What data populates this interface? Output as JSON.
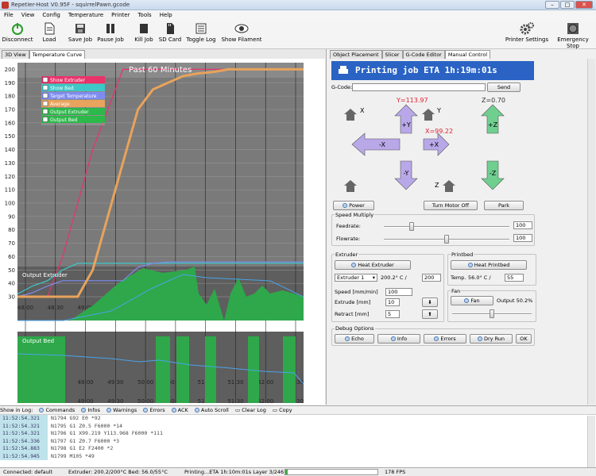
{
  "window": {
    "title": "Repetier-Host V0.95F - squirrelPawn.gcode"
  },
  "menu": [
    "File",
    "View",
    "Config",
    "Temperature",
    "Printer",
    "Tools",
    "Help"
  ],
  "toolbar": {
    "left": [
      {
        "name": "disconnect",
        "label": "Disconnect",
        "icon": "power-icon"
      },
      {
        "name": "load",
        "label": "Load",
        "icon": "document-icon"
      },
      {
        "name": "save-job",
        "label": "Save Job",
        "icon": "save-icon"
      },
      {
        "name": "pause-job",
        "label": "Pause Job",
        "icon": "pause-icon"
      },
      {
        "name": "kill-job",
        "label": "Kill Job",
        "icon": "stop-icon"
      },
      {
        "name": "sd-card",
        "label": "SD Card",
        "icon": "sd-card-icon"
      },
      {
        "name": "toggle-log",
        "label": "Toggle Log",
        "icon": "log-icon"
      },
      {
        "name": "show-filament",
        "label": "Show Filament",
        "icon": "eye-icon"
      }
    ],
    "right": [
      {
        "name": "printer-settings",
        "label": "Printer Settings",
        "icon": "gear-icon"
      },
      {
        "name": "emergency-stop",
        "label": "Emergency Stop",
        "icon": "emergency-icon"
      }
    ]
  },
  "left_tabs": [
    "3D View",
    "Temperature Curve"
  ],
  "right_tabs": [
    "Object Placement",
    "Slicer",
    "G-Code Editor",
    "Manual Control"
  ],
  "chart_data": {
    "type": "line",
    "title": "Past 60 Minutes",
    "x": [
      "48:00",
      "48:30",
      "49:00",
      "49:30",
      "50:00",
      "50:30",
      "51:00",
      "51:30",
      "52:00",
      "52:30"
    ],
    "ylim": [
      0,
      200
    ],
    "yticks": [
      200,
      190,
      180,
      170,
      160,
      150,
      140,
      130,
      120,
      110,
      100,
      90,
      80,
      70,
      60,
      50,
      40,
      30
    ],
    "legend": [
      {
        "label": "Show Extruder",
        "color": "#e8336b"
      },
      {
        "label": "Show Bed",
        "color": "#3ec7c7"
      },
      {
        "label": "Target Temperature",
        "color": "#7e8cf0"
      },
      {
        "label": "Average",
        "color": "#e8a35c"
      },
      {
        "label": "Output Extruder",
        "color": "#2db84a"
      },
      {
        "label": "Output Bed",
        "color": "#2db84a"
      }
    ],
    "series": [
      {
        "name": "Show Extruder",
        "color": "#e8336b",
        "values": [
          30,
          30,
          30,
          60,
          100,
          140,
          170,
          200,
          200,
          200,
          200,
          200,
          200,
          200,
          200,
          200,
          200,
          200,
          200,
          200
        ]
      },
      {
        "name": "Show Bed",
        "color": "#3ec7c7",
        "values": [
          32,
          38,
          42,
          50,
          55,
          55,
          55,
          55,
          55,
          55,
          55,
          55,
          55,
          55,
          55,
          55,
          55,
          55,
          55,
          55
        ]
      },
      {
        "name": "Target Temperature",
        "color": "#7e8cf0",
        "values": [
          30,
          33,
          38,
          42,
          42,
          42,
          42,
          42,
          52,
          55,
          56,
          56,
          56,
          56,
          56,
          56,
          56,
          56,
          56,
          56
        ]
      },
      {
        "name": "Average",
        "color": "#e8a35c",
        "values": [
          30,
          30,
          30,
          30,
          30,
          50,
          90,
          130,
          170,
          185,
          190,
          195,
          197,
          198,
          200,
          200,
          200,
          200,
          200,
          200
        ]
      }
    ],
    "output_extruder_title": "Output Extruder",
    "output_bed_title": "Output Bed"
  },
  "manual": {
    "eta": "Printing job ETA 1h:19m:01s",
    "gcode_label": "G-Code:",
    "send": "Send",
    "x_label": "X",
    "y_label": "Y",
    "z_label": "Z",
    "y_pos": "Y=113.97",
    "z_pos": "Z=0.70",
    "x_pos": "X=99.22",
    "jog": {
      "plus_y": "+Y",
      "minus_y": "-Y",
      "minus_x": "-X",
      "plus_x": "+X",
      "plus_z": "+Z",
      "minus_z": "-Z"
    },
    "power": "Power",
    "turn_motor_off": "Turn Motor Off",
    "park": "Park",
    "speed_group": "Speed Multiply",
    "feedrate": "Feedrate:",
    "feedrate_val": "100",
    "feedrate_pct": 0.21,
    "flowrate": "Flowrate:",
    "flowrate_val": "100",
    "flowrate_pct": 0.5,
    "extruder_group": "Extruder",
    "heat_extruder": "Heat Extruder",
    "extruder_select": "Extruder 1",
    "extruder_temp": "200.2° C /",
    "extruder_target": "200",
    "speed_label": "Speed [mm/min]",
    "speed_val": "100",
    "extrude_label": "Extrude [mm]",
    "extrude_val": "10",
    "retract_label": "Retract [mm]",
    "retract_val": "5",
    "printbed_group": "Printbed",
    "heat_printbed": "Heat Printbed",
    "temp_label": "Temp.",
    "bed_temp": "56.0° C /",
    "bed_target": "55",
    "fan_group": "Fan",
    "fan_button": "Fan",
    "fan_output": "Output 50.2%",
    "fan_pct": 0.5,
    "debug_group": "Debug Options",
    "debug": [
      "Echo",
      "Info",
      "Errors",
      "Dry Run"
    ],
    "ok": "OK"
  },
  "log": {
    "options": [
      "Show in Log:",
      "Commands",
      "Infos",
      "Warnings",
      "Errors",
      "ACK",
      "Auto Scroll",
      "Clear Log",
      "Copy"
    ],
    "rows": [
      {
        "t": "11:52:54.321",
        "c": "N1794 G92 E0 *92"
      },
      {
        "t": "11:52:54.321",
        "c": "N1795 G1 Z0.5 F6000 *14"
      },
      {
        "t": "11:52:54.321",
        "c": "N1796 G1 X99.219 Y113.968 F6000 *111"
      },
      {
        "t": "11:52:54.336",
        "c": "N1797 G1 Z0.7 F6000 *3"
      },
      {
        "t": "11:52:54.883",
        "c": "N1798 G1 E2 F2400 *2"
      },
      {
        "t": "11:52:54.945",
        "c": "N1799 M105 *49"
      }
    ]
  },
  "status": {
    "connected": "Connected: default",
    "temps": "Extruder: 200.2/200°C Bed: 56.0/55°C",
    "printing": "Printing...ETA 1h:10m:01s Layer 3/246",
    "progress": 0.03,
    "fps": "178 FPS"
  }
}
